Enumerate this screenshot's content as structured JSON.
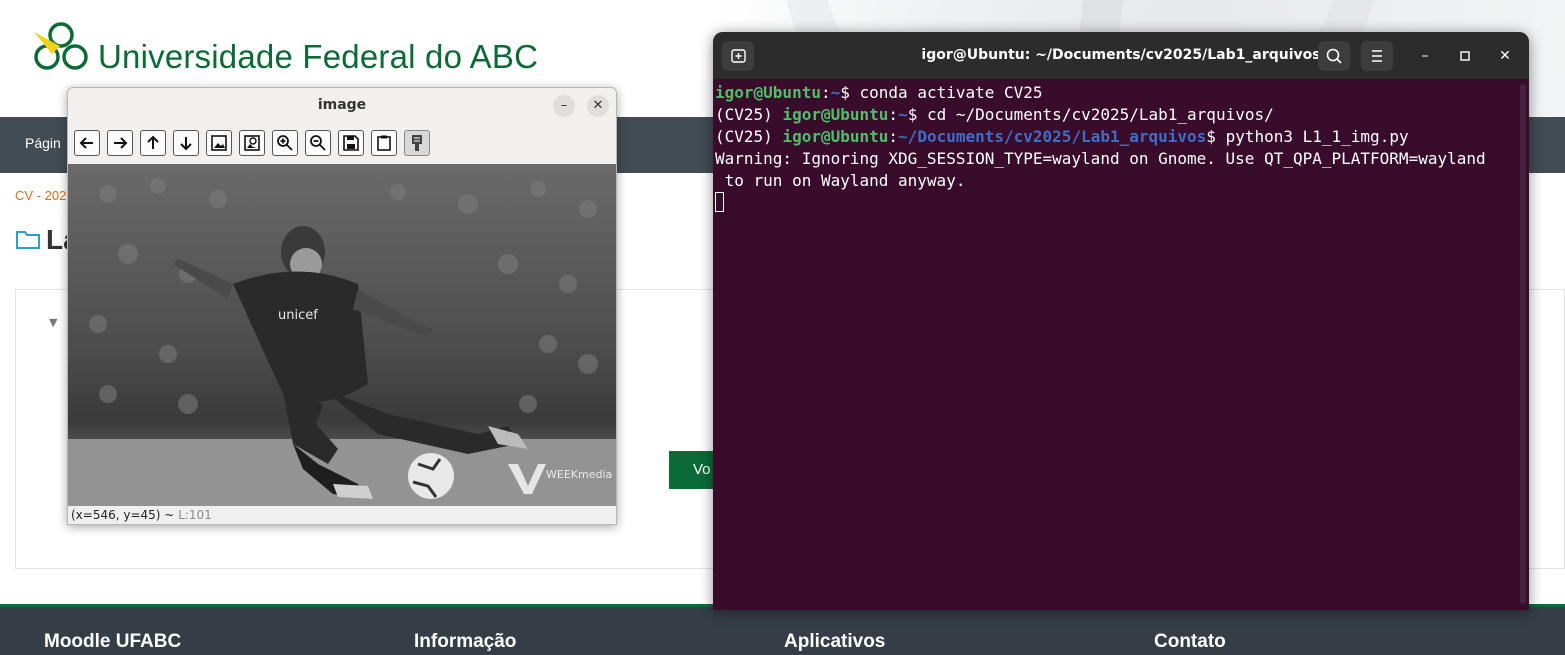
{
  "website": {
    "university_name": "Universidade Federal do ABC",
    "nav_item": "Págin",
    "breadcrumb": "CV - 202",
    "page_title": "La",
    "button_label": "Vo",
    "footer": [
      "Moodle UFABC",
      "Informação",
      "Aplicativos",
      "Contato"
    ],
    "brand_color": "#0b6b37"
  },
  "image_window": {
    "title": "image",
    "toolbar": [
      "arrow-left-icon",
      "arrow-right-icon",
      "arrow-up-icon",
      "arrow-down-icon",
      "image-icon",
      "image-zoom-icon",
      "zoom-in-icon",
      "zoom-out-icon",
      "save-icon",
      "clipboard-icon",
      "properties-icon"
    ],
    "photo_watermark": "WEEKmedia",
    "shirt_text": "unicef",
    "status_coords": "(x=546, y=45) ~",
    "status_luminance": "L:101"
  },
  "terminal": {
    "title": "igor@Ubuntu: ~/Documents/cv2025/Lab1_arquivos",
    "lines": [
      {
        "env": "",
        "user": "igor@Ubuntu",
        "sep": ":",
        "path": "~",
        "cmd": "$ conda activate CV25"
      },
      {
        "env": "(CV25) ",
        "user": "igor@Ubuntu",
        "sep": ":",
        "path": "~",
        "cmd": "$ cd ~/Documents/cv2025/Lab1_arquivos/"
      },
      {
        "env": "(CV25) ",
        "user": "igor@Ubuntu",
        "sep": ":",
        "path": "~/Documents/cv2025/Lab1_arquivos",
        "cmd": "$ python3 L1_1_img.py"
      }
    ],
    "warning_line1": "Warning: Ignoring XDG_SESSION_TYPE=wayland on Gnome. Use QT_QPA_PLATFORM=wayland",
    "warning_line2": " to run on Wayland anyway."
  }
}
